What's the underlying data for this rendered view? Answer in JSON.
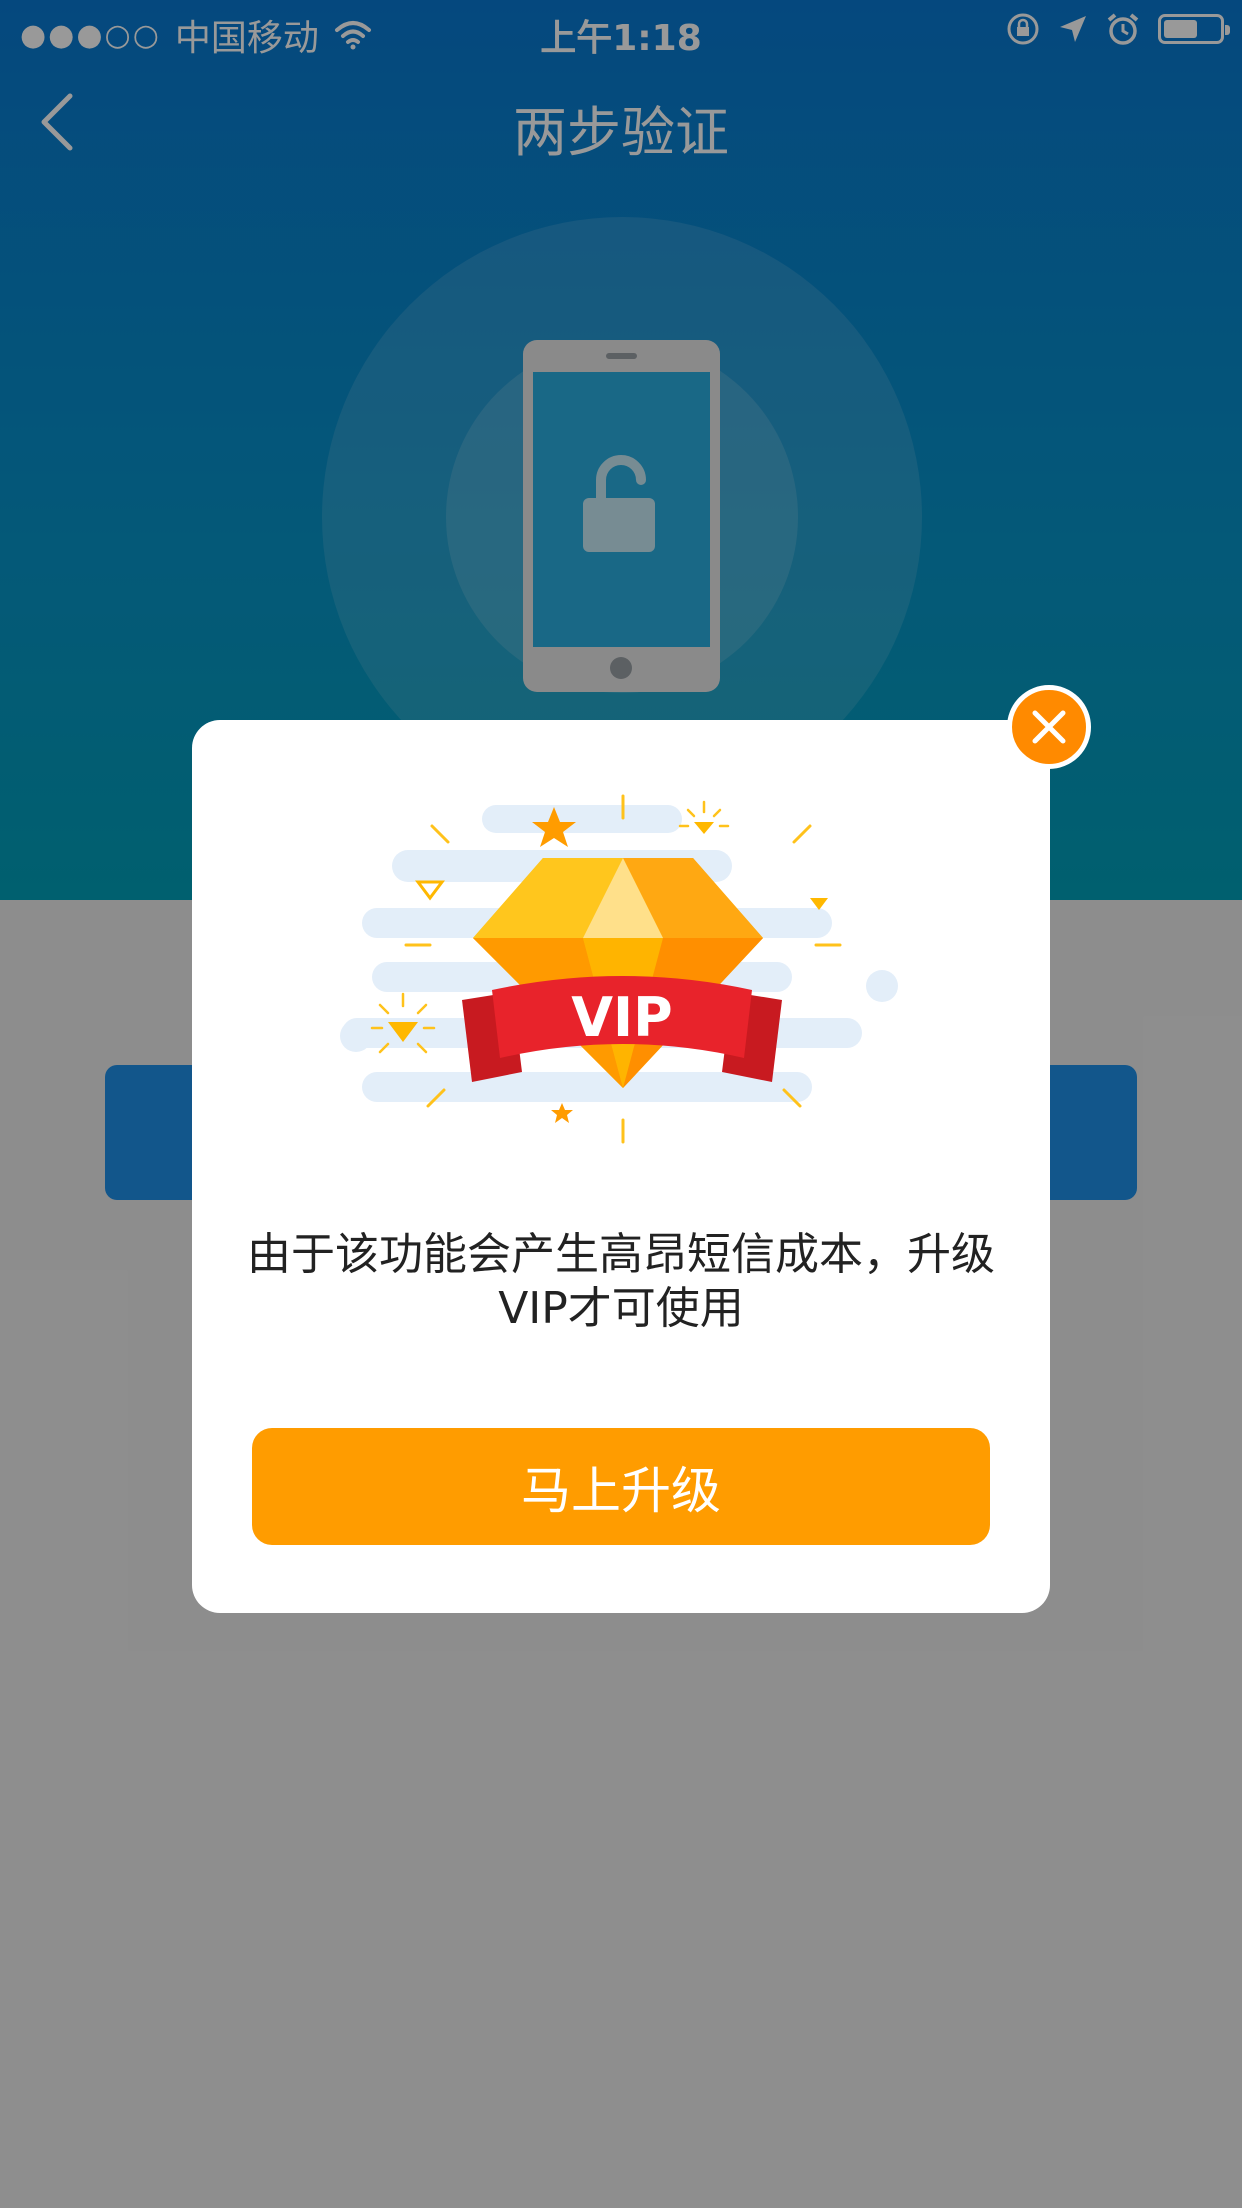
{
  "status_bar": {
    "carrier": "中国移动",
    "signal_dots": "●●●○○",
    "time": "上午1:18",
    "battery_level": 0.62
  },
  "nav": {
    "title": "两步验证"
  },
  "modal": {
    "badge_text": "VIP",
    "message": "由于该功能会产生高昂短信成本，升级VIP才可使用",
    "upgrade_label": "马上升级"
  },
  "colors": {
    "accent_orange": "#ff9c00",
    "close_orange": "#ff8a00",
    "hero_blue": "#0979d2",
    "ribbon_red": "#e8232b"
  },
  "icons": [
    "signal-icon",
    "wifi-icon",
    "orientation-lock-icon",
    "location-arrow-icon",
    "alarm-icon",
    "battery-icon",
    "back-chevron-icon",
    "phone-icon",
    "unlock-icon",
    "close-icon",
    "diamond-icon"
  ]
}
